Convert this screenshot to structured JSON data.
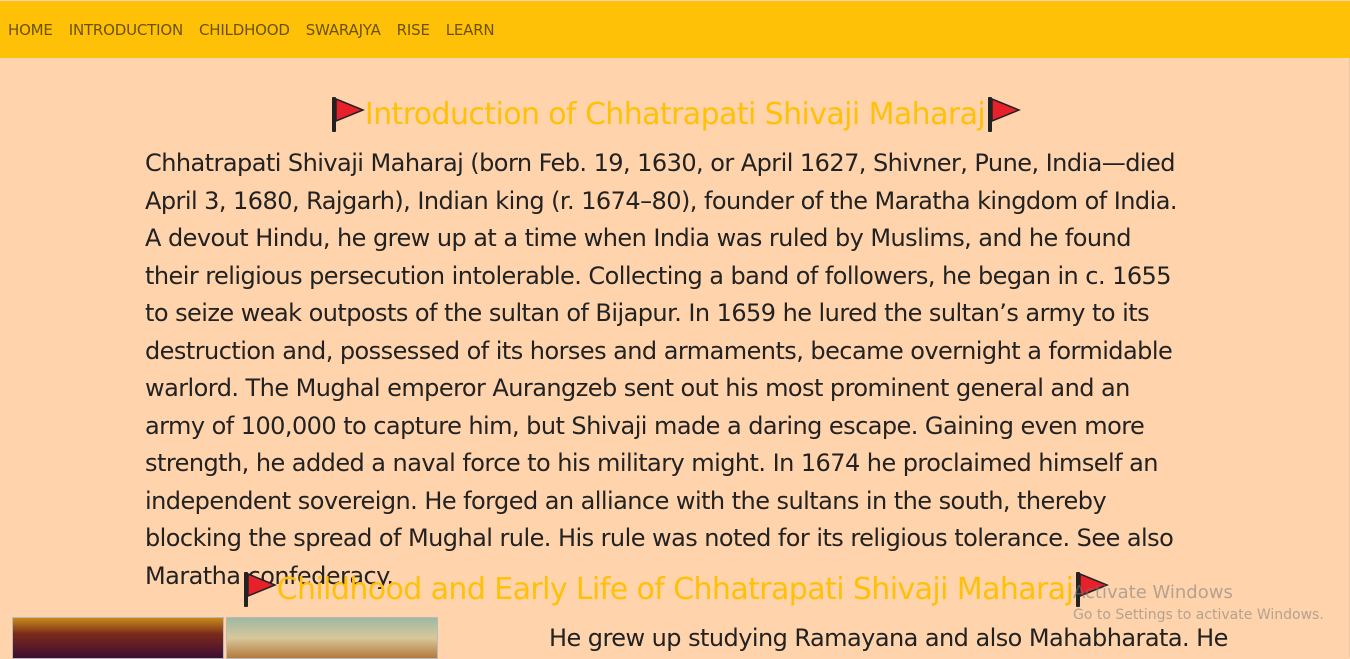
{
  "nav": {
    "items": [
      "HOME",
      "INTRODUCTION",
      "CHILDHOOD",
      "SWARAJYA",
      "RISE",
      "LEARN"
    ]
  },
  "section1": {
    "title": "Introduction of Chhatrapati Shivaji Maharaj",
    "body": "Chhatrapati Shivaji Maharaj (born Feb. 19, 1630, or April 1627, Shivner, Pune, India—died April 3, 1680, Rajgarh), Indian king (r. 1674–80), founder of the Maratha kingdom of India. A devout Hindu, he grew up at a time when India was ruled by Muslims, and he found their religious persecution intolerable. Collecting a band of followers, he began in c. 1655 to seize weak outposts of the sultan of Bijapur. In 1659 he lured the sultan’s army to its destruction and, possessed of its horses and armaments, became overnight a formidable warlord. The Mughal emperor Aurangzeb sent out his most prominent general and an army of 100,000 to capture him, but Shivaji made a daring escape. Gaining even more strength, he added a naval force to his military might. In 1674 he proclaimed himself an independent sovereign. He forged an alliance with the sultans in the south, thereby blocking the spread of Mughal rule. His rule was noted for its religious tolerance. See also Maratha confederacy."
  },
  "section2": {
    "title": "Childhood and Early Life of Chhatrapati Shivaji Maharaj",
    "body_first_line": "He grew up studying Ramayana and also Mahabharata. He"
  },
  "watermark": {
    "line1": "Activate Windows",
    "line2": "Go to Settings to activate Windows."
  },
  "icons": {
    "flag": "flag-icon"
  },
  "colors": {
    "nav_bg": "#ffc107",
    "page_bg": "#ffd3ac",
    "heading": "#ffc107",
    "flag": "#e8202a"
  }
}
